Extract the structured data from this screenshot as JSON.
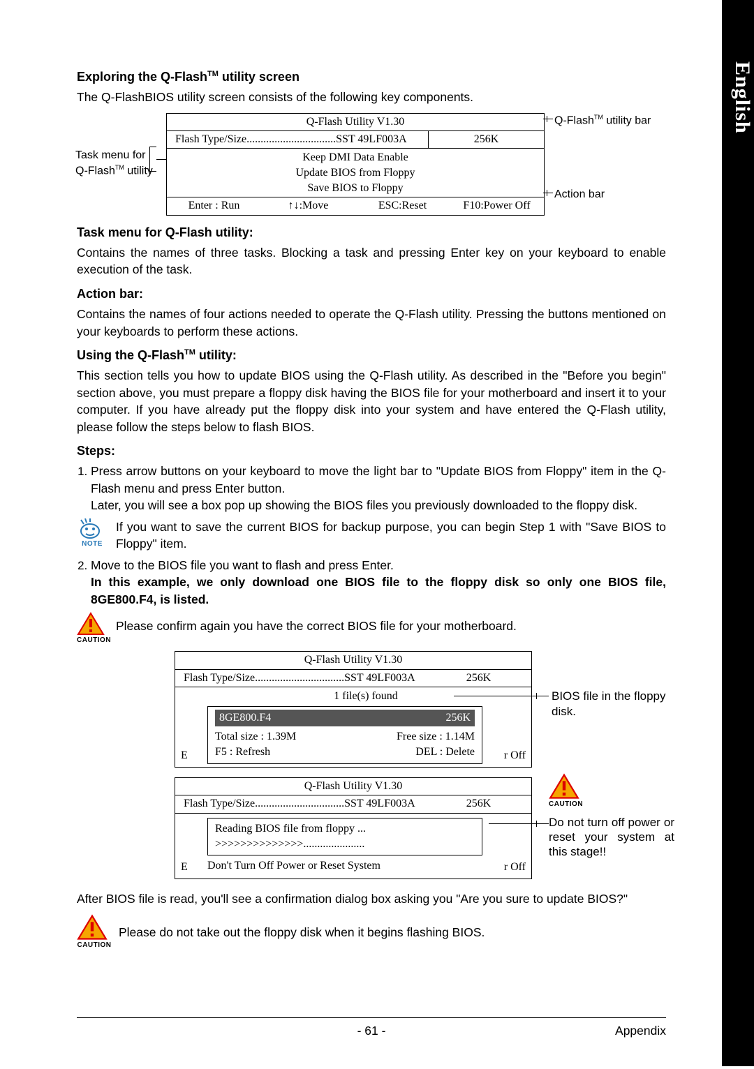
{
  "side_tab": "English",
  "headings": {
    "exploring": "Exploring the Q-Flash™ utility screen",
    "task_menu": "Task menu for Q-Flash utility:",
    "action_bar": "Action bar:",
    "using": "Using the Q-Flash™ utility:",
    "steps": "Steps:"
  },
  "body": {
    "exploring_p": "The Q-FlashBIOS utility screen consists of the following key components.",
    "task_p": "Contains the names of three tasks. Blocking a task and pressing Enter key on your keyboard to enable execution of the task.",
    "action_p": "Contains the names of four actions needed to operate the Q-Flash utility. Pressing the buttons mentioned on your keyboards to perform these actions.",
    "using_p": "This section tells you how to update BIOS using the Q-Flash utility. As described in the \"Before you begin\" section above, you must prepare a floppy disk having the BIOS file for your motherboard and insert it to your computer. If you have already put the floppy disk into your system and have entered the Q-Flash utility, please follow the steps below to flash BIOS.",
    "step1_a": "Press arrow buttons on your keyboard to move the light bar to \"Update BIOS from Floppy\" item in the Q-Flash menu and press Enter button.",
    "step1_b": "Later, you will see a box pop up showing the BIOS files you previously downloaded to the floppy disk.",
    "note1": "If you want to save the current BIOS for backup purpose, you can begin Step 1 with \"Save BIOS to Floppy\" item.",
    "step2_a": "Move to the BIOS file you want to flash and press Enter.",
    "step2_b": "In this example, we only download one BIOS file to the floppy disk so only one BIOS file, 8GE800.F4, is listed.",
    "caution1": "Please confirm again you have the correct BIOS file for your motherboard.",
    "after_read": "After BIOS file is read, you'll see a confirmation dialog box asking you \"Are you sure to update BIOS?\"",
    "caution2": "Please do not take out the floppy disk when it begins flashing BIOS."
  },
  "dia1": {
    "title": "Q-Flash Utility V1.30",
    "type_label": "Flash Type/Size................................SST 49LF003A",
    "size": "256K",
    "menu1": "Keep DMI Data    Enable",
    "menu2": "Update BIOS from Floppy",
    "menu3": "Save BIOS to Floppy",
    "a1": "Enter : Run",
    "a2": "↑↓:Move",
    "a3": "ESC:Reset",
    "a4": "F10:Power Off",
    "label_taskmenu": "Task menu for Q-Flash™ utility",
    "label_utilitybar": "Q-Flash™ utility bar",
    "label_actionbar": "Action bar"
  },
  "dia2": {
    "title": "Q-Flash Utility V1.30",
    "type_label": "Flash Type/Size................................SST 49LF003A",
    "size": "256K",
    "files_found": "1 file(s) found",
    "file_name": "8GE800.F4",
    "file_size": "256K",
    "total": "Total size : 1.39M",
    "free": "Free size : 1.14M",
    "refresh": "F5 : Refresh",
    "delete": "DEL : Delete",
    "eleft": "E",
    "eoff": "r Off",
    "ann": "BIOS file in the floppy disk."
  },
  "dia3": {
    "title": "Q-Flash Utility V1.30",
    "type_label": "Flash Type/Size................................SST 49LF003A",
    "size": "256K",
    "reading": "Reading BIOS file from floppy ...",
    "progress": ">>>>>>>>>>>>>>......................",
    "warn": "Don't Turn Off Power or Reset System",
    "eleft": "E",
    "eoff": "r Off",
    "ann": "Do not turn off power or reset your system at this stage!!"
  },
  "footer": {
    "page": "- 61 -",
    "section": "Appendix"
  },
  "icons": {
    "note": "NOTE",
    "caution": "CAUTION"
  }
}
